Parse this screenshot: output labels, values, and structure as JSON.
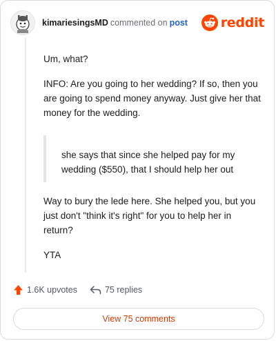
{
  "header": {
    "username": "kimariesingsMD",
    "commented_text": "commented on",
    "post_link": "post",
    "brand_name": "reddit"
  },
  "comment": {
    "paragraph_1": "Um, what?",
    "paragraph_2": "INFO: Are you going to her wedding? If so, then you are going to spend money anyway. Just give her that money for the wedding.",
    "quote": "she says that since she helped pay for my wedding ($550), that I should help her out",
    "paragraph_3": "Way to bury the lede here. She helped you, but you just don't \"think it's right\" for you to help her in return?",
    "paragraph_4": "YTA"
  },
  "footer": {
    "upvotes": "1.6K upvotes",
    "replies": "75 replies",
    "view_comments": "View 75 comments"
  },
  "colors": {
    "reddit_orange": "#ff4500",
    "link_blue": "#1f62c8",
    "view_button_text": "#d93a00"
  },
  "icons": {
    "avatar": "snoo-avatar",
    "brand": "reddit-logo-icon",
    "upvote": "upvote-arrow-icon",
    "reply": "reply-arrow-icon"
  }
}
